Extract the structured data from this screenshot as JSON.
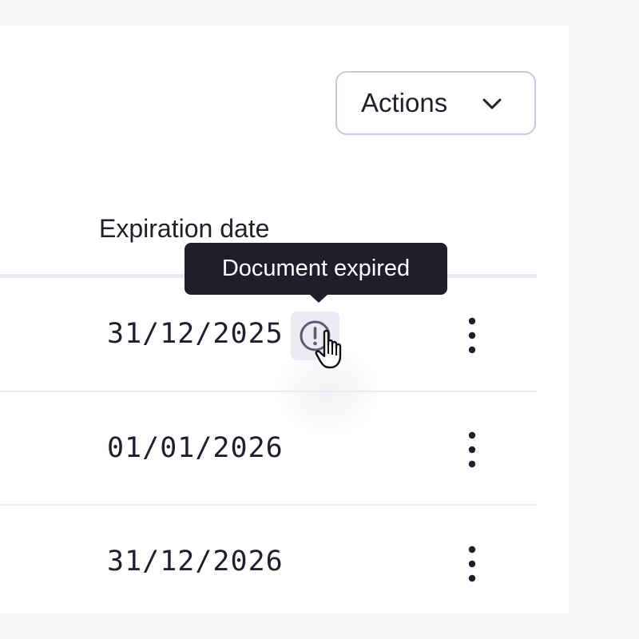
{
  "toolbar": {
    "actions_label": "Actions",
    "actions_icon": "chevron-down-icon"
  },
  "table": {
    "columns": [
      "Expiration date"
    ],
    "rows": [
      {
        "expiration_date": "31/12/2025",
        "status_icon": "alert-circle-icon",
        "row_menu_icon": "kebab-menu-icon"
      },
      {
        "expiration_date": "01/01/2026",
        "row_menu_icon": "kebab-menu-icon"
      },
      {
        "expiration_date": "31/12/2026",
        "row_menu_icon": "kebab-menu-icon"
      }
    ]
  },
  "tooltip": {
    "text": "Document expired"
  },
  "colors": {
    "tooltip_bg": "#1e1f2b",
    "icon_color": "#5c5a72",
    "border": "#c9c7dd"
  }
}
